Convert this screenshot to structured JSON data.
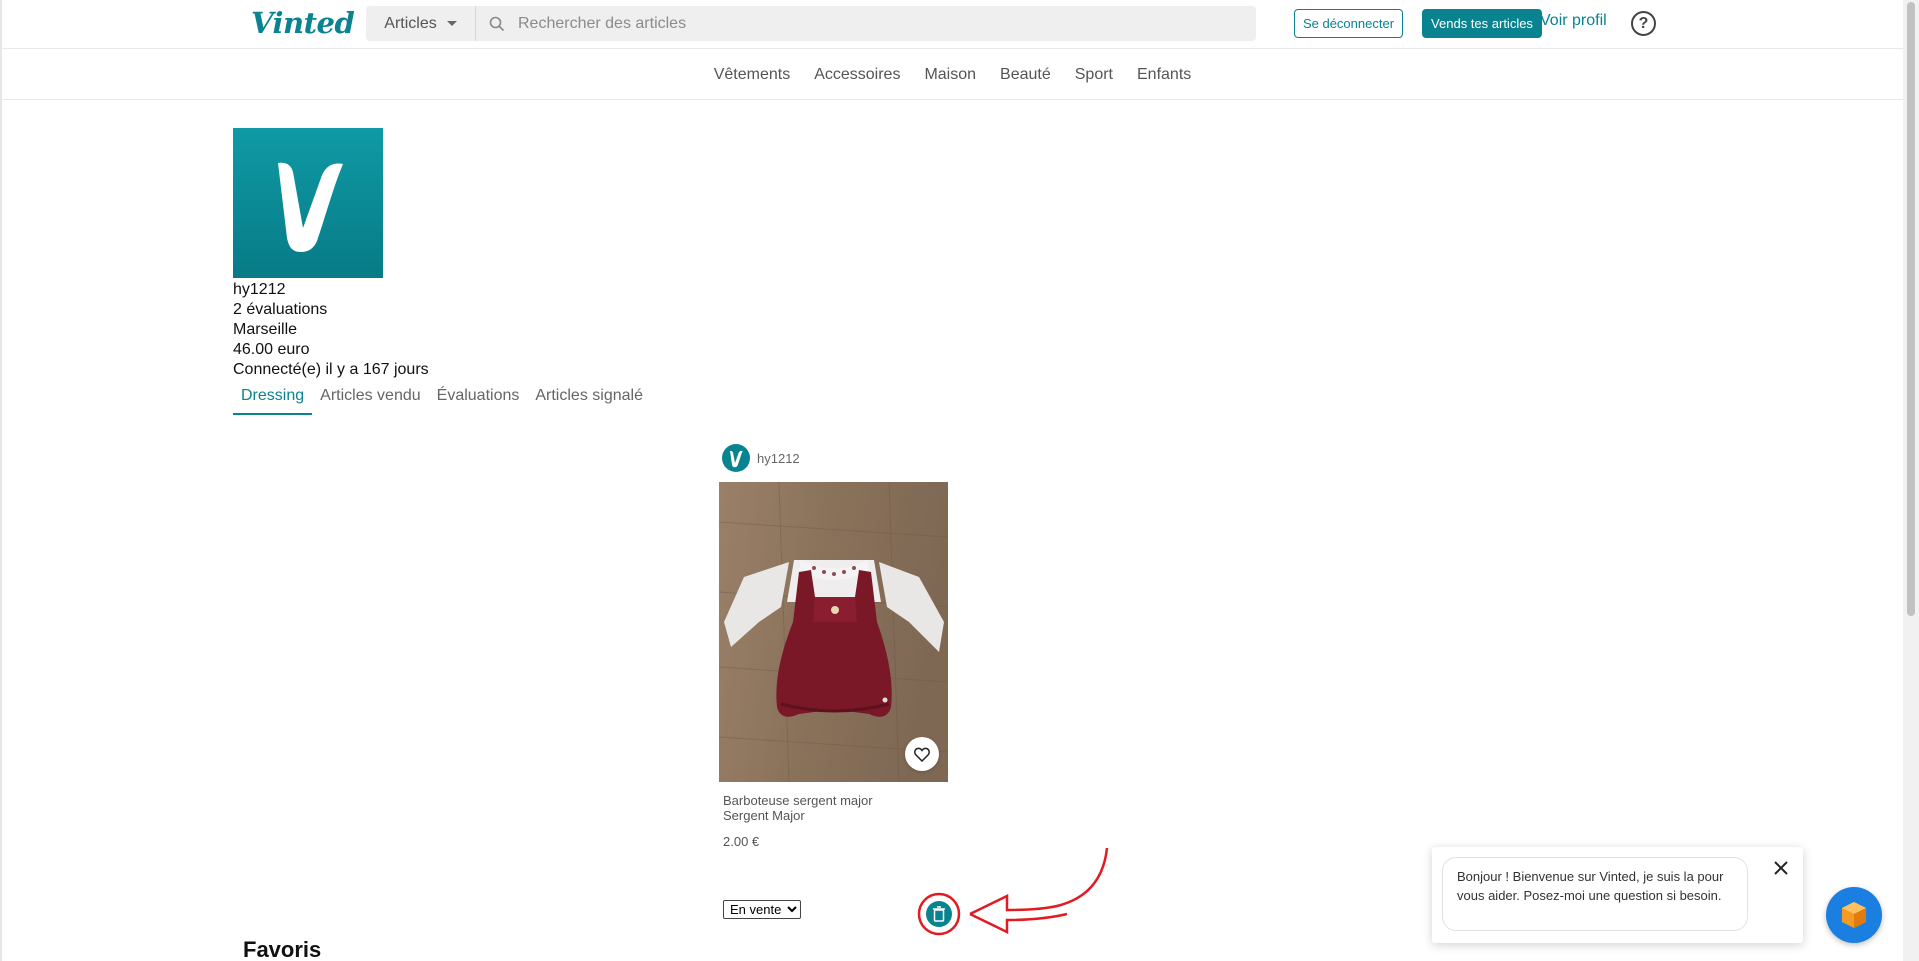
{
  "header": {
    "logo": "Vinted",
    "category_select": "Articles",
    "search_placeholder": "Rechercher des articles",
    "logout_label": "Se déconnecter",
    "sell_label": "Vends tes articles",
    "profile_label": "Voir profil",
    "help_glyph": "?"
  },
  "categories": [
    "Vêtements",
    "Accessoires",
    "Maison",
    "Beauté",
    "Sport",
    "Enfants"
  ],
  "profile": {
    "avatar_letter": "V",
    "username": "hy1212",
    "reviews": "2 évaluations",
    "city": "Marseille",
    "balance": "46.00 euro",
    "last_seen": "Connecté(e) il y a 167 jours"
  },
  "tabs": [
    {
      "label": "Dressing",
      "active": true
    },
    {
      "label": "Articles vendu",
      "active": false
    },
    {
      "label": "Évaluations",
      "active": false
    },
    {
      "label": "Articles signalé",
      "active": false
    }
  ],
  "item": {
    "seller": "hy1212",
    "avatar_letter": "V",
    "title": "Barboteuse sergent major",
    "brand": "Sergent Major",
    "price": "2.00 €",
    "status_selected": "En vente",
    "favourite_icon": "heart-icon",
    "delete_icon": "trash-icon"
  },
  "favorites_title": "Favoris",
  "chat": {
    "message": "Bonjour ! Bienvenue sur Vinted, je suis la pour vous aider. Posez-moi une question si besoin.",
    "close_icon": "close-icon",
    "launcher_icon": "chat-bot-icon"
  },
  "colors": {
    "brand": "#09838f",
    "annotation": "#e11b22"
  }
}
